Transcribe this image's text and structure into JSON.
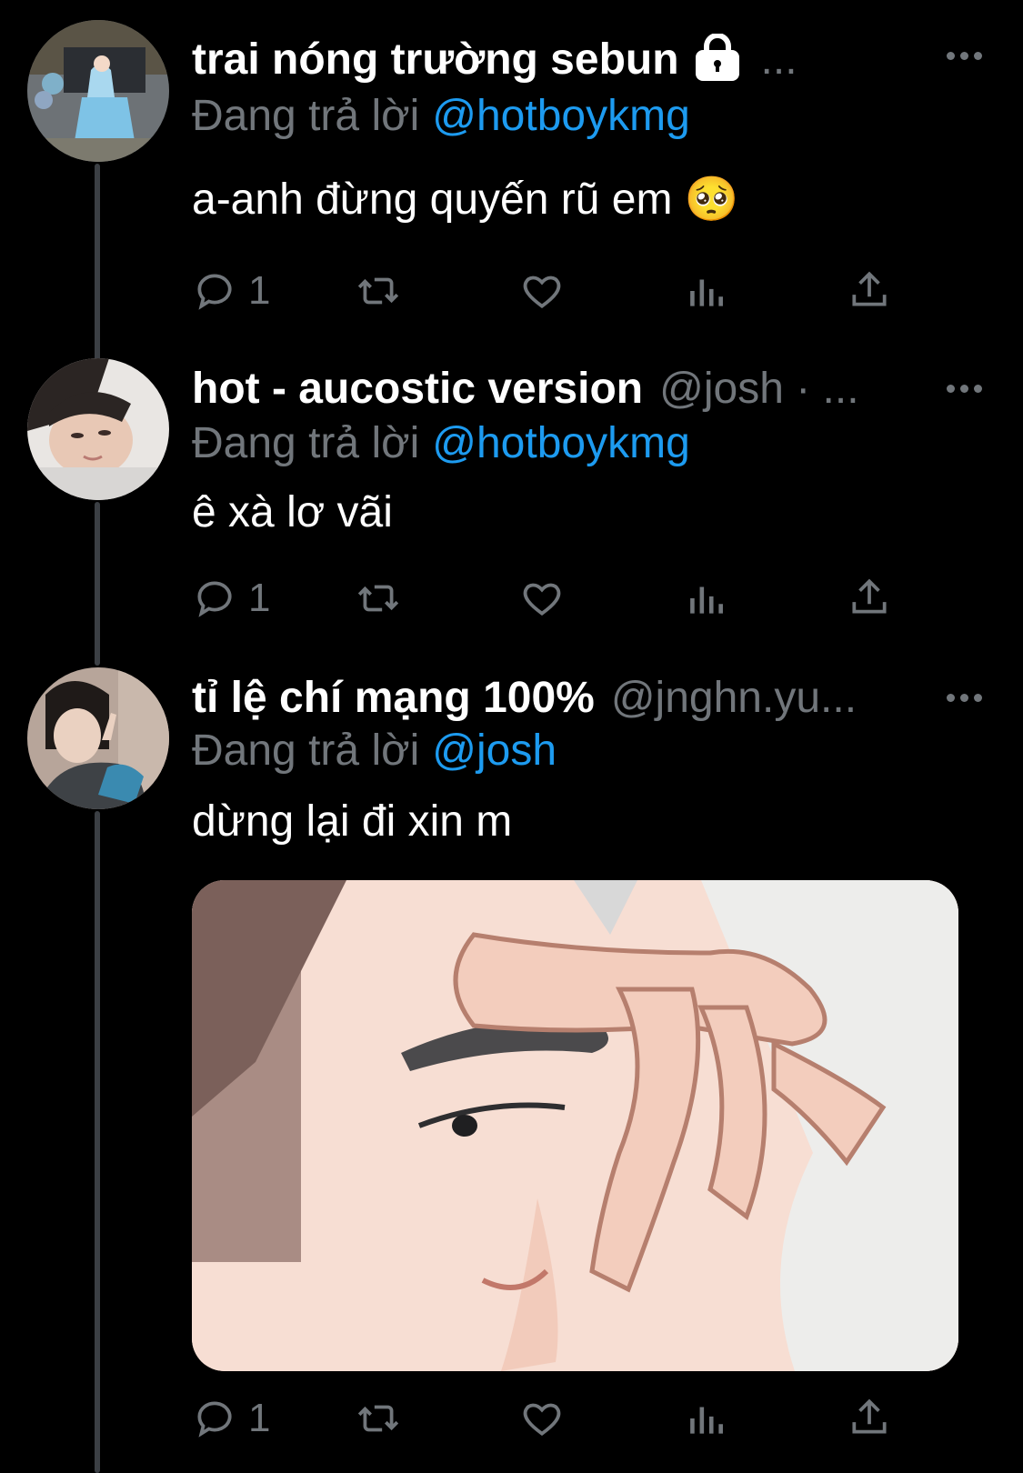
{
  "tweets": [
    {
      "name": "trai nóng trường sebun",
      "handle": "",
      "trailing": "...",
      "reply_prefix": "Đang trả lời",
      "reply_to": "@hotboykmg",
      "text": "a-anh đừng quyến rũ em 🥺",
      "reply_count": "1",
      "locked": true,
      "avatar": "avatar-elsa-statue"
    },
    {
      "name": "hot - aucostic version",
      "handle": "@josh · ...",
      "trailing": "",
      "reply_prefix": "Đang trả lời",
      "reply_to": "@hotboykmg",
      "text": "ê xà lơ vãi",
      "reply_count": "1",
      "locked": false,
      "avatar": "avatar-girl-lying"
    },
    {
      "name": "tỉ lệ chí mạng 100%",
      "handle": "@jnghn.yu...",
      "trailing": "",
      "reply_prefix": "Đang trả lời",
      "reply_to": "@josh",
      "text": "dừng lại đi xin m",
      "reply_count": "1",
      "locked": false,
      "avatar": "avatar-person-peace-sign"
    }
  ],
  "icons": [
    "reply-icon",
    "retweet-icon",
    "like-icon",
    "views-icon",
    "share-icon",
    "more-icon",
    "lock-icon"
  ],
  "colors": {
    "background": "#000000",
    "text": "#ffffff",
    "muted": "#71767b",
    "link": "#1d9bf0",
    "thread_line": "#3b3f44"
  },
  "media": {
    "description_icon": "cartoon-face-image"
  }
}
